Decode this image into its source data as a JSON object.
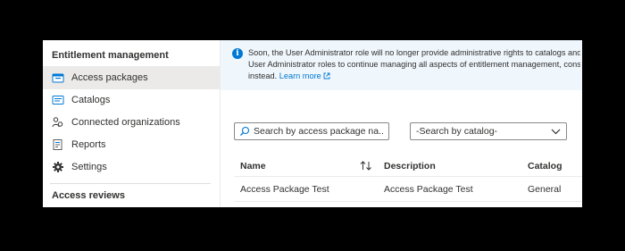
{
  "sidebar": {
    "section_title": "Entitlement management",
    "items": [
      {
        "label": "Access packages",
        "icon": "access-packages-icon",
        "active": true
      },
      {
        "label": "Catalogs",
        "icon": "catalog-icon"
      },
      {
        "label": "Connected organizations",
        "icon": "connected-organizations-icon"
      },
      {
        "label": "Reports",
        "icon": "reports-icon"
      },
      {
        "label": "Settings",
        "icon": "gear-icon"
      }
    ],
    "section2_title": "Access reviews"
  },
  "banner": {
    "icon": "info-icon",
    "line1": "Soon, the User Administrator role will no longer provide administrative rights to catalogs and",
    "line2": "User Administrator roles to continue managing all aspects of entitlement management, cons",
    "line3": "instead.",
    "link": "Learn more"
  },
  "search": {
    "placeholder": "Search by access package na..."
  },
  "catalog_filter": {
    "value": "-Search by catalog-"
  },
  "table": {
    "columns": [
      "Name",
      "Description",
      "Catalog"
    ],
    "rows": [
      [
        "Access Package Test",
        "Access Package Test",
        "General"
      ]
    ]
  },
  "colors": {
    "accent": "#0078d4",
    "banner_bg": "#eff6fc",
    "active_item_bg": "#ebeae8"
  }
}
